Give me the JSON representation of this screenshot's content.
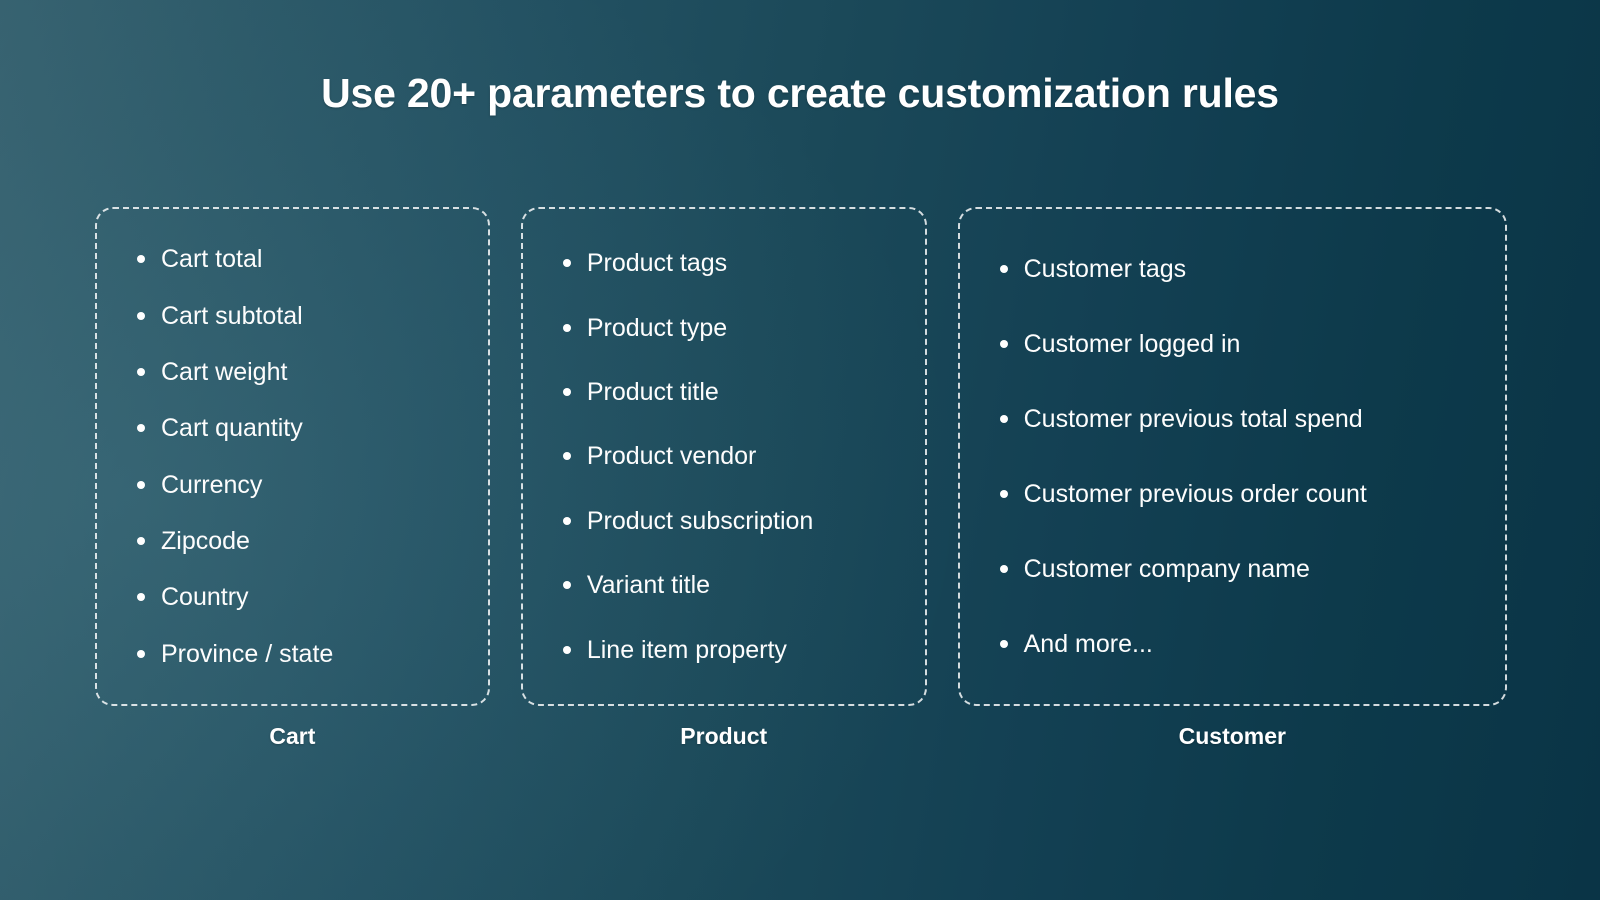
{
  "page": {
    "title": "Use 20+ parameters to create customization rules",
    "background": {
      "gradient_from": "#36616f",
      "gradient_to": "#0a3446"
    },
    "text_color": "#ffffff",
    "border_color": "#ffffff"
  },
  "columns": [
    {
      "id": "cart",
      "caption": "Cart",
      "items": [
        "Cart total",
        "Cart subtotal",
        "Cart weight",
        "Cart quantity",
        "Currency",
        "Zipcode",
        "Country",
        "Province / state"
      ]
    },
    {
      "id": "product",
      "caption": "Product",
      "items": [
        "Product tags",
        "Product type",
        "Product title",
        "Product vendor",
        "Product subscription",
        "Variant title",
        "Line item property"
      ]
    },
    {
      "id": "customer",
      "caption": "Customer",
      "items": [
        "Customer tags",
        "Customer logged in",
        "Customer previous total spend",
        "Customer previous order count",
        "Customer company name",
        "And more..."
      ]
    }
  ]
}
